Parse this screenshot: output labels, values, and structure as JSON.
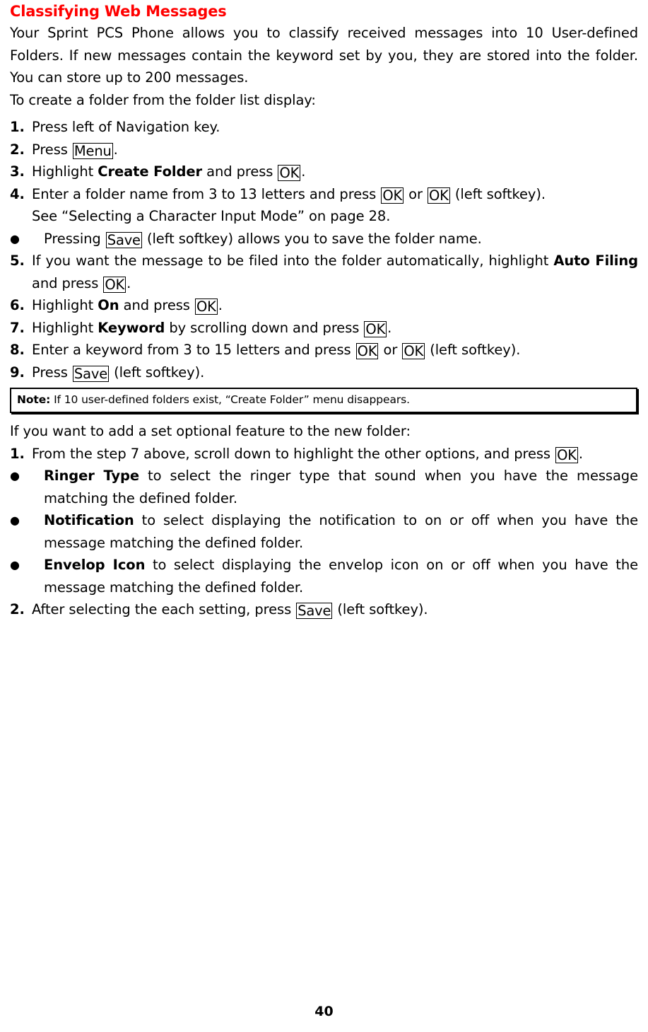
{
  "heading": "Classifying Web Messages",
  "intro": {
    "paragraph": "Your Sprint PCS Phone allows you to classify received messages into 10 User-defined Folders. If new messages contain the keyword set by you, they are stored into the folder. You can store up to 200 messages.",
    "lead_in": "To create a folder from the folder list display:"
  },
  "steps": [
    {
      "num": "1.",
      "parts": [
        {
          "type": "text",
          "value": "Press left of Navigation key."
        }
      ]
    },
    {
      "num": "2.",
      "parts": [
        {
          "type": "text",
          "value": "Press "
        },
        {
          "type": "key",
          "value": "Menu"
        },
        {
          "type": "text",
          "value": "."
        }
      ]
    },
    {
      "num": "3.",
      "parts": [
        {
          "type": "text",
          "value": "Highlight "
        },
        {
          "type": "bold",
          "value": "Create Folder"
        },
        {
          "type": "text",
          "value": " and press "
        },
        {
          "type": "key",
          "value": "OK"
        },
        {
          "type": "text",
          "value": "."
        }
      ]
    },
    {
      "num": "4.",
      "parts": [
        {
          "type": "text",
          "value": "Enter a folder name from 3 to 13 letters and press "
        },
        {
          "type": "key",
          "value": "OK"
        },
        {
          "type": "text",
          "value": " or "
        },
        {
          "type": "key",
          "value": "OK"
        },
        {
          "type": "text",
          "value": " (left softkey)."
        }
      ]
    },
    {
      "num": "5.",
      "parts": [
        {
          "type": "text",
          "value": "If you want the message to be filed into the folder automatically, highlight "
        },
        {
          "type": "bold",
          "value": "Auto Filing"
        },
        {
          "type": "text",
          "value": " and press "
        },
        {
          "type": "key",
          "value": "OK"
        },
        {
          "type": "text",
          "value": "."
        }
      ]
    },
    {
      "num": "6.",
      "parts": [
        {
          "type": "text",
          "value": "Highlight "
        },
        {
          "type": "bold",
          "value": "On"
        },
        {
          "type": "text",
          "value": " and press "
        },
        {
          "type": "key",
          "value": "OK"
        },
        {
          "type": "text",
          "value": "."
        }
      ]
    },
    {
      "num": "7.",
      "parts": [
        {
          "type": "text",
          "value": "Highlight "
        },
        {
          "type": "bold",
          "value": "Keyword"
        },
        {
          "type": "text",
          "value": " by scrolling down and press "
        },
        {
          "type": "key",
          "value": "OK"
        },
        {
          "type": "text",
          "value": "."
        }
      ]
    },
    {
      "num": "8.",
      "parts": [
        {
          "type": "text",
          "value": "Enter a keyword from 3 to 15 letters and press "
        },
        {
          "type": "key",
          "value": "OK"
        },
        {
          "type": "text",
          "value": " or "
        },
        {
          "type": "key",
          "value": "OK"
        },
        {
          "type": "text",
          "value": " (left softkey)."
        }
      ]
    },
    {
      "num": "9.",
      "parts": [
        {
          "type": "text",
          "value": "Press "
        },
        {
          "type": "key",
          "value": "Save"
        },
        {
          "type": "text",
          "value": " (left softkey)."
        }
      ]
    }
  ],
  "see_reference": "See “Selecting a Character Input Mode” on page 28.",
  "pressing_save_bullet": [
    {
      "type": "text",
      "value": "Pressing "
    },
    {
      "type": "key",
      "value": "Save"
    },
    {
      "type": "text",
      "value": " (left softkey) allows you to save the folder name."
    }
  ],
  "note": {
    "label": "Note:",
    "text": "If 10 user-defined folders exist, “Create Folder” menu disappears."
  },
  "optional": {
    "lead_in": "If you want to add a set optional feature to the new folder:",
    "steps": [
      {
        "num": "1.",
        "parts": [
          {
            "type": "text",
            "value": "From the step 7 above, scroll down to highlight the other options, and press "
          },
          {
            "type": "key",
            "value": "OK"
          },
          {
            "type": "text",
            "value": "."
          }
        ]
      },
      {
        "num": "2.",
        "parts": [
          {
            "type": "text",
            "value": "After selecting the each setting, press "
          },
          {
            "type": "key",
            "value": "Save"
          },
          {
            "type": "text",
            "value": " (left softkey)."
          }
        ]
      }
    ],
    "bullets": [
      [
        {
          "type": "bold",
          "value": "Ringer Type"
        },
        {
          "type": "text",
          "value": " to select the ringer type that sound when you have the message matching the defined folder."
        }
      ],
      [
        {
          "type": "bold",
          "value": "Notification"
        },
        {
          "type": "text",
          "value": " to select displaying the notification to on or off when you have the message matching the defined folder."
        }
      ],
      [
        {
          "type": "bold",
          "value": "Envelop Icon"
        },
        {
          "type": "text",
          "value": " to select displaying the envelop icon on or off when you have the message matching the defined folder."
        }
      ]
    ]
  },
  "bullet_glyph": "●",
  "page_number": "40",
  "colors": {
    "heading": "#ff0000",
    "body": "#000000",
    "background": "#ffffff"
  }
}
